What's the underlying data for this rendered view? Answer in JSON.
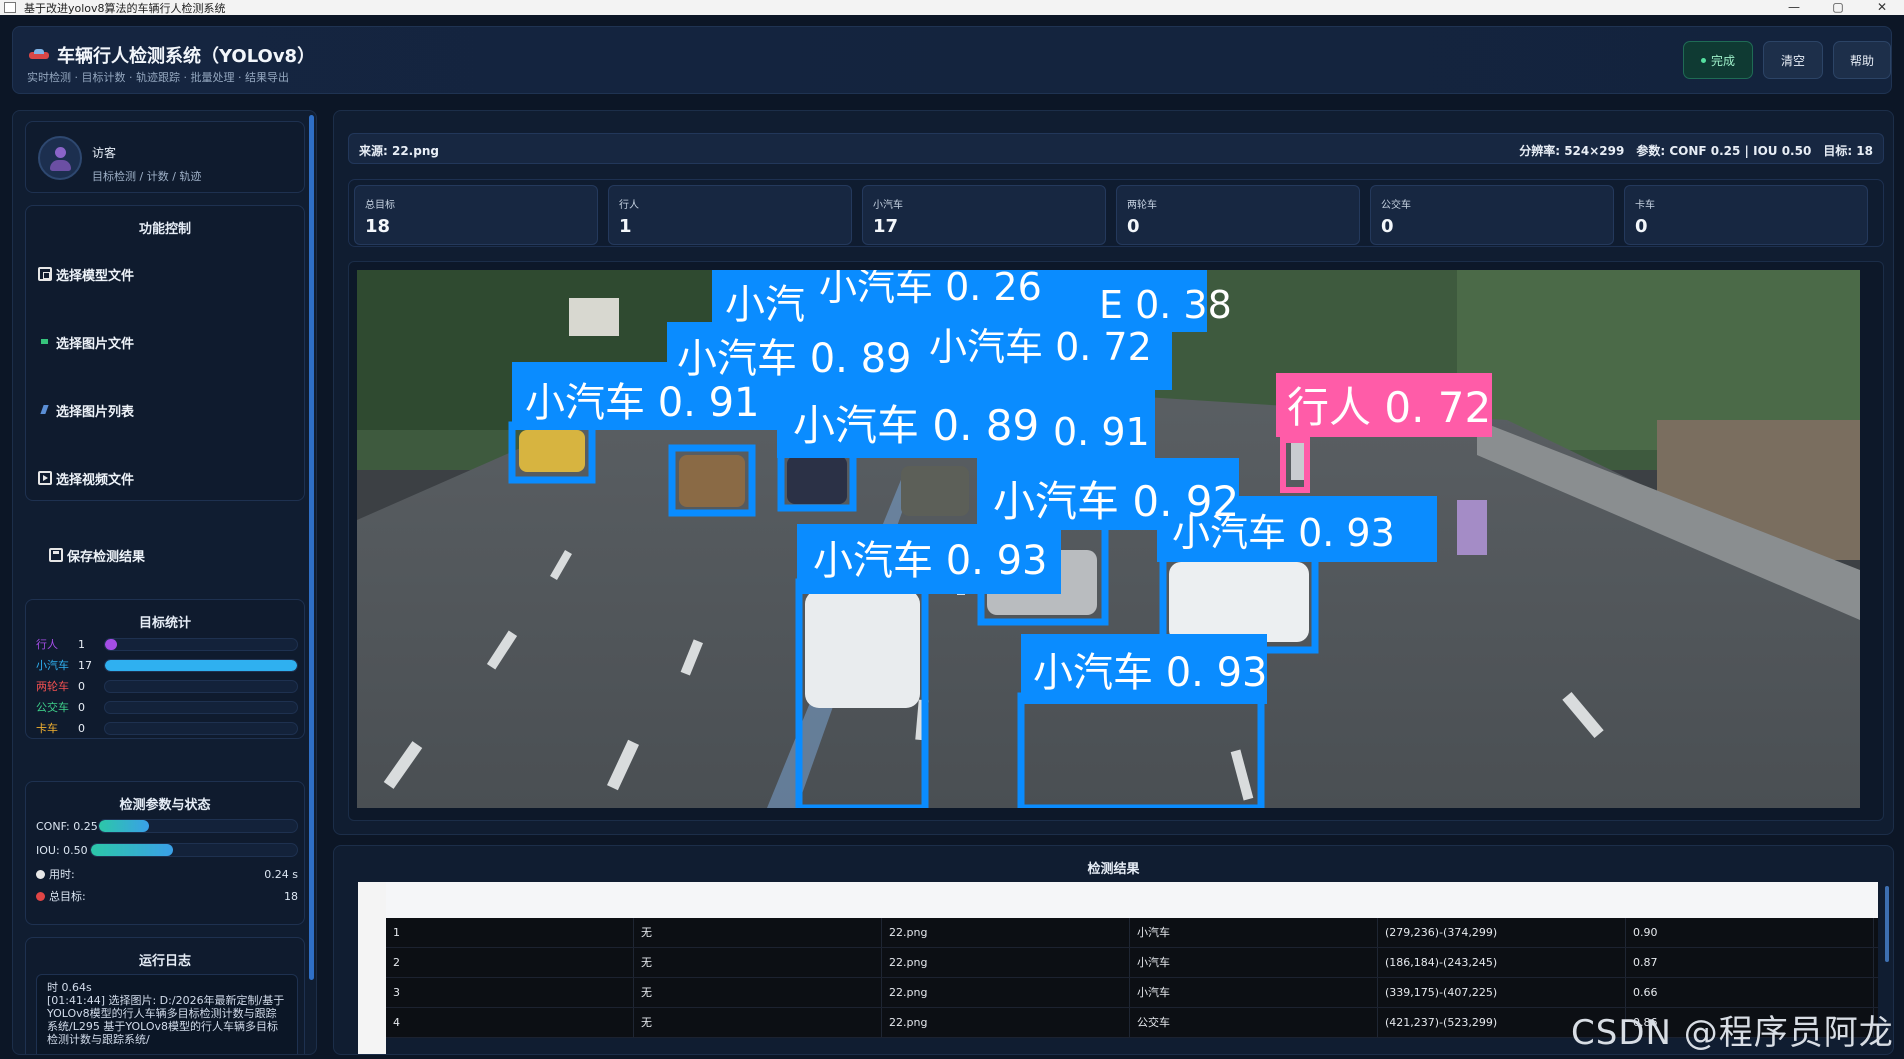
{
  "window": {
    "title": "基于改进yolov8算法的车辆行人检测系统",
    "controls": [
      "—",
      "▢",
      "✕"
    ]
  },
  "header": {
    "title": "车辆行人检测系统（YOLOv8）",
    "subtitle": "实时检测 · 目标计数 · 轨迹跟踪 · 批量处理 · 结果导出",
    "status_label": "完成",
    "clear_label": "清空",
    "help_label": "帮助"
  },
  "user": {
    "name": "访客",
    "desc": "目标检测 / 计数 / 轨迹"
  },
  "functions": {
    "title": "功能控制",
    "items": [
      {
        "label": "选择模型文件",
        "icon": "model-file-icon"
      },
      {
        "label": "选择图片文件",
        "icon": "image-file-icon"
      },
      {
        "label": "选择图片列表",
        "icon": "image-list-icon"
      },
      {
        "label": "选择视频文件",
        "icon": "video-file-icon"
      },
      {
        "label": "保存检测结果",
        "icon": "save-icon"
      }
    ]
  },
  "stats": {
    "title": "目标统计",
    "rows": [
      {
        "label": "行人",
        "count": "1",
        "ratio": 0.06,
        "color": "#a44de6"
      },
      {
        "label": "小汽车",
        "count": "17",
        "ratio": 1.0,
        "color": "#2fb0f0"
      },
      {
        "label": "两轮车",
        "count": "0",
        "ratio": 0,
        "color": "#f05050"
      },
      {
        "label": "公交车",
        "count": "0",
        "ratio": 0,
        "color": "#3ed08a"
      },
      {
        "label": "卡车",
        "count": "0",
        "ratio": 0,
        "color": "#f0b030"
      }
    ]
  },
  "params": {
    "title": "检测参数与状态",
    "conf_label": "CONF: 0.25",
    "conf": 0.25,
    "iou_label": "IOU: 0.50",
    "iou": 0.5,
    "time_label": "用时:",
    "time_value": "0.24 s",
    "total_label": "总目标:",
    "total_value": "18"
  },
  "log": {
    "title": "运行日志",
    "lines": [
      "时 0.64s",
      "[01:41:44] 选择图片: D:/2026年最新定制/基于YOLOv8模型的行人车辆多目标检测计数与跟踪系统/L295 基于YOLOv8模型的行人车辆多目标检测计数与跟踪系统/"
    ]
  },
  "info": {
    "source": "来源: 22.png",
    "resolution": "分辨率: 524×299",
    "params": "参数: CONF 0.25 | IOU 0.50",
    "targets": "目标: 18"
  },
  "counts": [
    {
      "label": "总目标",
      "value": "18"
    },
    {
      "label": "行人",
      "value": "1"
    },
    {
      "label": "小汽车",
      "value": "17"
    },
    {
      "label": "两轮车",
      "value": "0"
    },
    {
      "label": "公交车",
      "value": "0"
    },
    {
      "label": "卡车",
      "value": "0"
    }
  ],
  "detections": [
    {
      "label": "小汽 "
    },
    {
      "label": "小汽车 0. 26"
    },
    {
      "label": "E 0. 38"
    },
    {
      "label": "小汽车 0. 89"
    },
    {
      "label": "小汽车 0. 72"
    },
    {
      "label": "小汽车 0. 91"
    },
    {
      "label": "小汽车 0. 89"
    },
    {
      "label": "0. 91"
    },
    {
      "label": "行人 0. 72"
    },
    {
      "label": "小汽车 0. 92"
    },
    {
      "label": "小汽车 0. 93"
    },
    {
      "label": "小汽车 0. 93"
    },
    {
      "label": "小汽车 0. 93"
    }
  ],
  "results": {
    "title": "检测结果",
    "rows": [
      [
        "1",
        "无",
        "22.png",
        "小汽车",
        "(279,236)-(374,299)",
        "0.90"
      ],
      [
        "2",
        "无",
        "22.png",
        "小汽车",
        "(186,184)-(243,245)",
        "0.87"
      ],
      [
        "3",
        "无",
        "22.png",
        "小汽车",
        "(339,175)-(407,225)",
        "0.66"
      ],
      [
        "4",
        "无",
        "22.png",
        "公交车",
        "(421,237)-(523,299)",
        "0.86"
      ]
    ]
  },
  "watermark": "CSDN @程序员阿龙"
}
